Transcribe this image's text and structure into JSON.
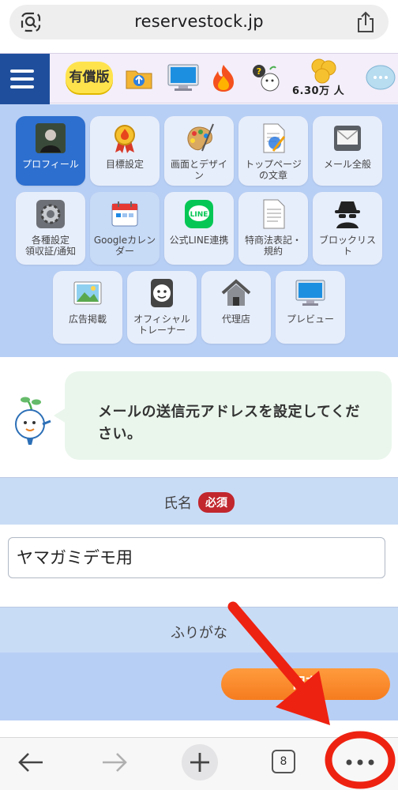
{
  "browser": {
    "url": "reservestock.jp",
    "tabs_count": "8"
  },
  "header": {
    "paid_badge": "有償版",
    "coin_count": "6.30万 人"
  },
  "menu": {
    "items": [
      {
        "label": "プロフィール",
        "icon": "profile-photo-icon",
        "active": true
      },
      {
        "label": "目標設定",
        "icon": "medal-icon"
      },
      {
        "label": "画面とデザイン",
        "icon": "palette-icon"
      },
      {
        "label": "トップページの文章",
        "icon": "document-edit-icon"
      },
      {
        "label": "メール全般",
        "icon": "mail-icon"
      },
      {
        "label": "各種設定\n領収証/通知",
        "icon": "gear-icon"
      },
      {
        "label": "Googleカレンダー",
        "icon": "calendar-icon"
      },
      {
        "label": "公式LINE連携",
        "icon": "line-icon"
      },
      {
        "label": "特商法表記・規約",
        "icon": "legal-document-icon"
      },
      {
        "label": "ブロックリスト",
        "icon": "spy-icon"
      },
      {
        "label": "広告掲載",
        "icon": "photo-ad-icon"
      },
      {
        "label": "オフィシャルトレーナー",
        "icon": "trainer-icon"
      },
      {
        "label": "代理店",
        "icon": "house-icon"
      },
      {
        "label": "プレビュー",
        "icon": "monitor-icon"
      }
    ]
  },
  "notice": {
    "message": "メールの送信元アドレスを設定してください。"
  },
  "form": {
    "name_label": "氏名",
    "required_label": "必須",
    "name_value": "ヤマガミデモ用",
    "furigana_label": "ふりがな",
    "save_label": "保存"
  },
  "colors": {
    "accent_blue": "#2d6fcf",
    "required_red": "#c1272d",
    "save_orange": "#f57c1f",
    "annotation_red": "#ee2211"
  }
}
